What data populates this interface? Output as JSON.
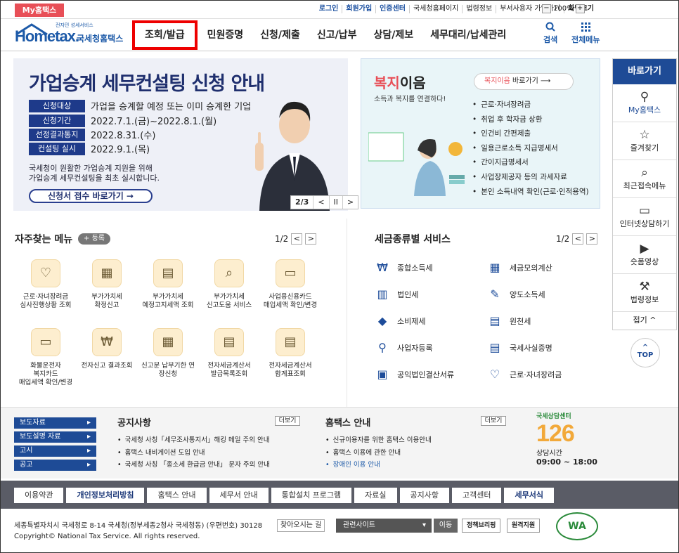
{
  "util": {
    "myhome": "My홈택스",
    "links": [
      "로그인",
      "회원가입",
      "인증센터",
      "국세청홈페이지",
      "법령정보",
      "부서사용자 가입하기",
      "화면크기"
    ],
    "zoom": "100%",
    "zoom_minus": "−",
    "zoom_plus": "+"
  },
  "header": {
    "logo_small": "전자민 성세서비스",
    "logo_big": "Hometax.",
    "logo_kor": "국세청홈택스",
    "nav": [
      "조회/발급",
      "민원증명",
      "신청/제출",
      "신고/납부",
      "상담/제보",
      "세무대리/납세관리"
    ],
    "search_label": "검색",
    "menu_label": "전체메뉴"
  },
  "banner": {
    "title": "가업승계 세무컨설팅 신청 안내",
    "rows": [
      {
        "tag": "신청대상",
        "text": "가업을 승계할 예정 또는 이미 승계한 기업"
      },
      {
        "tag": "신청기간",
        "text": "2022.7.1.(금)~2022.8.1.(월)"
      },
      {
        "tag": "선정결과통지",
        "text": "2022.8.31.(수)"
      },
      {
        "tag": "컨설팅 실시",
        "text": "2022.9.1.(목)"
      }
    ],
    "desc1": "국세청이 원활한 가업승계 지원을 위해",
    "desc2": "가업승계 세무컨설팅을 최초 실시합니다.",
    "button": "신청서 접수 바로가기  →",
    "page": "2/3",
    "prev": "<",
    "pause": "II",
    "next": ">"
  },
  "welfare": {
    "title_a": "복지",
    "title_b": "이음",
    "subtitle": "소득과 복지를 연결하다!",
    "button_a": "복지이음",
    "button_b": " 바로가기  ⟶",
    "items": [
      "근로·자녀장려금",
      "취업 후 학자금 상환",
      "인건비 간편제출",
      "일용근로소득 지급명세서",
      "간이지급명세서",
      "사업장제공자 등의 과세자료",
      "본인 소득내역 확인(근로·인적용역)"
    ]
  },
  "sidebar": {
    "head": "바로가기",
    "items": [
      {
        "label": "My홈택스",
        "icon": "person-icon"
      },
      {
        "label": "즐겨찾기",
        "icon": "star-icon"
      },
      {
        "label": "최근접속메뉴",
        "icon": "recent-search-icon"
      },
      {
        "label": "인터넷상담하기",
        "icon": "chat-monitor-icon"
      },
      {
        "label": "숏폼영상",
        "icon": "video-play-icon"
      },
      {
        "label": "법령정보",
        "icon": "gavel-icon"
      }
    ],
    "fold": "접기 ^",
    "top": "TOP"
  },
  "freq": {
    "title": "자주찾는 메뉴",
    "register": "+ 등록",
    "page": "1/2",
    "items": [
      "근로·자녀장려금|심사진행상황 조회",
      "부가가치세|확정신고",
      "부가가치세|예정고지세액 조회",
      "부가가치세|신고도움 서비스",
      "사업용신용카드|매입세액 확인/변경",
      "화물운전자|복지카드|매입세액 확인/변경",
      "전자신고 결과조회",
      "신고분 납부기한 연|장신청",
      "전자세금계산서|발급목록조회",
      "전자세금계산서|합계표조회"
    ]
  },
  "tax": {
    "title": "세금종류별 서비스",
    "page": "1/2",
    "left": [
      "종합소득세",
      "법인세",
      "소비제세",
      "사업자등록",
      "공익법인결산서류"
    ],
    "right": [
      "세금모의계산",
      "양도소득세",
      "원천세",
      "국세사실증명",
      "근로·자녀장려금"
    ]
  },
  "notice": {
    "side_buttons": [
      "보도자료",
      "보도설명 자료",
      "고시",
      "공고"
    ],
    "title": "공지사항",
    "more": "더보기",
    "items": [
      "국세청 사칭「세무조사통지서」해킹 메일 주의 안내",
      "홈택스 내비게이션 도입 안내",
      "국세청 사칭 「종소세 환급금 안내」 문자 주의 안내"
    ],
    "ht_title": "홈택스 안내",
    "ht_more": "더보기",
    "ht_items": [
      "신규이용자를 위한 홈택스 이용안내",
      "홈택스 이용에 관한 안내",
      "장애인 이용 안내"
    ],
    "center_title": "국세상담센터",
    "center_num": "126",
    "center_hours_label": "상담시간",
    "center_hours": "09:00 ~ 18:00"
  },
  "footer": {
    "nav": [
      "이용약관",
      "개인정보처리방침",
      "홈택스 안내",
      "세무서 안내",
      "통합설치 프로그램",
      "자료실",
      "공지사항",
      "고객센터",
      "세무서식"
    ],
    "address": "세종특별자치시 국세청로 8-14 국세청(정부세종2청사 국세청동) (우편번호) 30128",
    "find": "찾아오시는 길",
    "copyright": "Copyright© National Tax Service. All rights reserved.",
    "related": "관련사이트",
    "go": "이동",
    "btn1": "정책브리핑",
    "btn2": "원격지원",
    "wa": "WA"
  },
  "colors": {
    "brand": "#1e4b96",
    "accent_red": "#e84f57",
    "highlight_border": "#ee0000"
  }
}
